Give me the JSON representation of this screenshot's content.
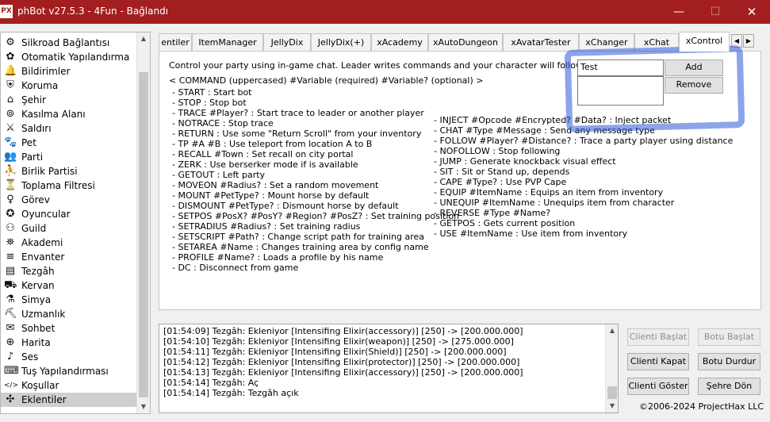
{
  "window": {
    "title": "phBot v27.5.3 - 4Fun - Bağlandı",
    "icon_text": "PX",
    "minimize_icon": "minimize-icon",
    "maximize_icon": "maximize-icon",
    "close_icon": "close-icon",
    "titlebar_color": "#a31f1f"
  },
  "sidebar": {
    "items": [
      {
        "label": "Silkroad Bağlantısı",
        "icon": "⚙"
      },
      {
        "label": "Otomatik Yapılandırma",
        "icon": "✿"
      },
      {
        "label": "Bildirimler",
        "icon": "🔔"
      },
      {
        "label": "Koruma",
        "icon": "⛨"
      },
      {
        "label": "Şehir",
        "icon": "⌂"
      },
      {
        "label": "Kasılma Alanı",
        "icon": "⊚"
      },
      {
        "label": "Saldırı",
        "icon": "⚔"
      },
      {
        "label": "Pet",
        "icon": "🐾"
      },
      {
        "label": "Parti",
        "icon": "👥"
      },
      {
        "label": "Birlik Partisi",
        "icon": "⛹"
      },
      {
        "label": "Toplama Filtresi",
        "icon": "⏳"
      },
      {
        "label": "Görev",
        "icon": "♀"
      },
      {
        "label": "Oyuncular",
        "icon": "✪"
      },
      {
        "label": "Guild",
        "icon": "⚇"
      },
      {
        "label": "Akademi",
        "icon": "⛯"
      },
      {
        "label": "Envanter",
        "icon": "≡"
      },
      {
        "label": "Tezgâh",
        "icon": "▤"
      },
      {
        "label": "Kervan",
        "icon": "⛟"
      },
      {
        "label": "Simya",
        "icon": "⚗"
      },
      {
        "label": "Uzmanlık",
        "icon": "⛏"
      },
      {
        "label": "Sohbet",
        "icon": "✉"
      },
      {
        "label": "Harita",
        "icon": "⊕"
      },
      {
        "label": "Ses",
        "icon": "♪"
      },
      {
        "label": "Tuş Yapılandırması",
        "icon": "⌨"
      },
      {
        "label": "Koşullar",
        "icon": "</>"
      },
      {
        "label": "Eklentiler",
        "icon": "✣"
      }
    ],
    "selected_index": 25
  },
  "tabs": [
    {
      "label": "entiler"
    },
    {
      "label": "ItemManager"
    },
    {
      "label": "JellyDix"
    },
    {
      "label": "JellyDix(+)"
    },
    {
      "label": "xAcademy"
    },
    {
      "label": "xAutoDungeon"
    },
    {
      "label": "xAvatarTester"
    },
    {
      "label": "xChanger"
    },
    {
      "label": "xChat"
    },
    {
      "label": "xControl"
    }
  ],
  "tab_scroll": {
    "left": "◀",
    "right": "▶"
  },
  "panel": {
    "intro": "Control your party using in-game chat. Leader writes commands and your character will follow it.",
    "syntax": "< COMMAND (uppercased) #Variable (required) #Variable? (optional) >",
    "commands_left": [
      "- START : Start bot",
      "- STOP : Stop bot",
      "- TRACE #Player? : Start trace to leader or another player",
      "- NOTRACE : Stop trace",
      "- RETURN : Use some \"Return Scroll\" from your inventory",
      "- TP #A #B : Use teleport from location A to B",
      "- RECALL #Town : Set recall on city portal",
      "- ZERK : Use berserker mode if is available",
      "- GETOUT : Left party",
      "- MOVEON #Radius? : Set a random movement",
      "- MOUNT #PetType? : Mount horse by default",
      "- DISMOUNT #PetType? : Dismount horse by default",
      "- SETPOS #PosX? #PosY? #Region? #PosZ? : Set training position",
      "- SETRADIUS #Radius? : Set training radius",
      "- SETSCRIPT #Path? : Change script path for training area",
      "- SETAREA #Name : Changes training area by config name",
      "- PROFILE #Name? : Loads a profile by his name",
      "- DC : Disconnect from game"
    ],
    "commands_right": [
      "- INJECT #Opcode #Encrypted? #Data? : Inject packet",
      "- CHAT #Type #Message : Send any message type",
      "- FOLLOW #Player? #Distance? : Trace a party player using distance",
      "- NOFOLLOW : Stop following",
      "- JUMP : Generate knockback visual effect",
      "- SIT : Sit or Stand up, depends",
      "- CAPE #Type? : Use PVP Cape",
      "- EQUIP #ItemName : Equips an item from inventory",
      "- UNEQUIP #ItemName : Unequips item from character",
      "- REVERSE #Type #Name?",
      "- GETPOS : Gets current position",
      "- USE #ItemName : Use item from inventory"
    ],
    "leader_input_value": "Test",
    "add_label": "Add",
    "remove_label": "Remove",
    "highlight_color": "#2d5bd8"
  },
  "log": {
    "lines": [
      "[01:54:09] Tezgâh: Ekleniyor [Intensifing Elixir(accessory)] [250] -> [200.000.000]",
      "[01:54:10] Tezgâh: Ekleniyor [Intensifing Elixir(weapon)] [250] -> [275.000.000]",
      "[01:54:11] Tezgâh: Ekleniyor [Intensifing Elixir(Shield)] [250] -> [200.000.000]",
      "[01:54:12] Tezgâh: Ekleniyor [Intensifing Elixir(protector)] [250] -> [200.000.000]",
      "[01:54:13] Tezgâh: Ekleniyor [Intensifing Elixir(accessory)] [250] -> [200.000.000]",
      "[01:54:14] Tezgâh: Aç",
      "[01:54:14] Tezgâh: Tezgâh açık"
    ]
  },
  "controls": {
    "client_start": "Clienti Başlat",
    "bot_start": "Botu Başlat",
    "client_close": "Clienti Kapat",
    "bot_stop": "Botu Durdur",
    "client_show": "Clienti Göster",
    "return_town": "Şehre Dön"
  },
  "footer": {
    "copyright": "©2006-2024 ProjectHax LLC"
  }
}
